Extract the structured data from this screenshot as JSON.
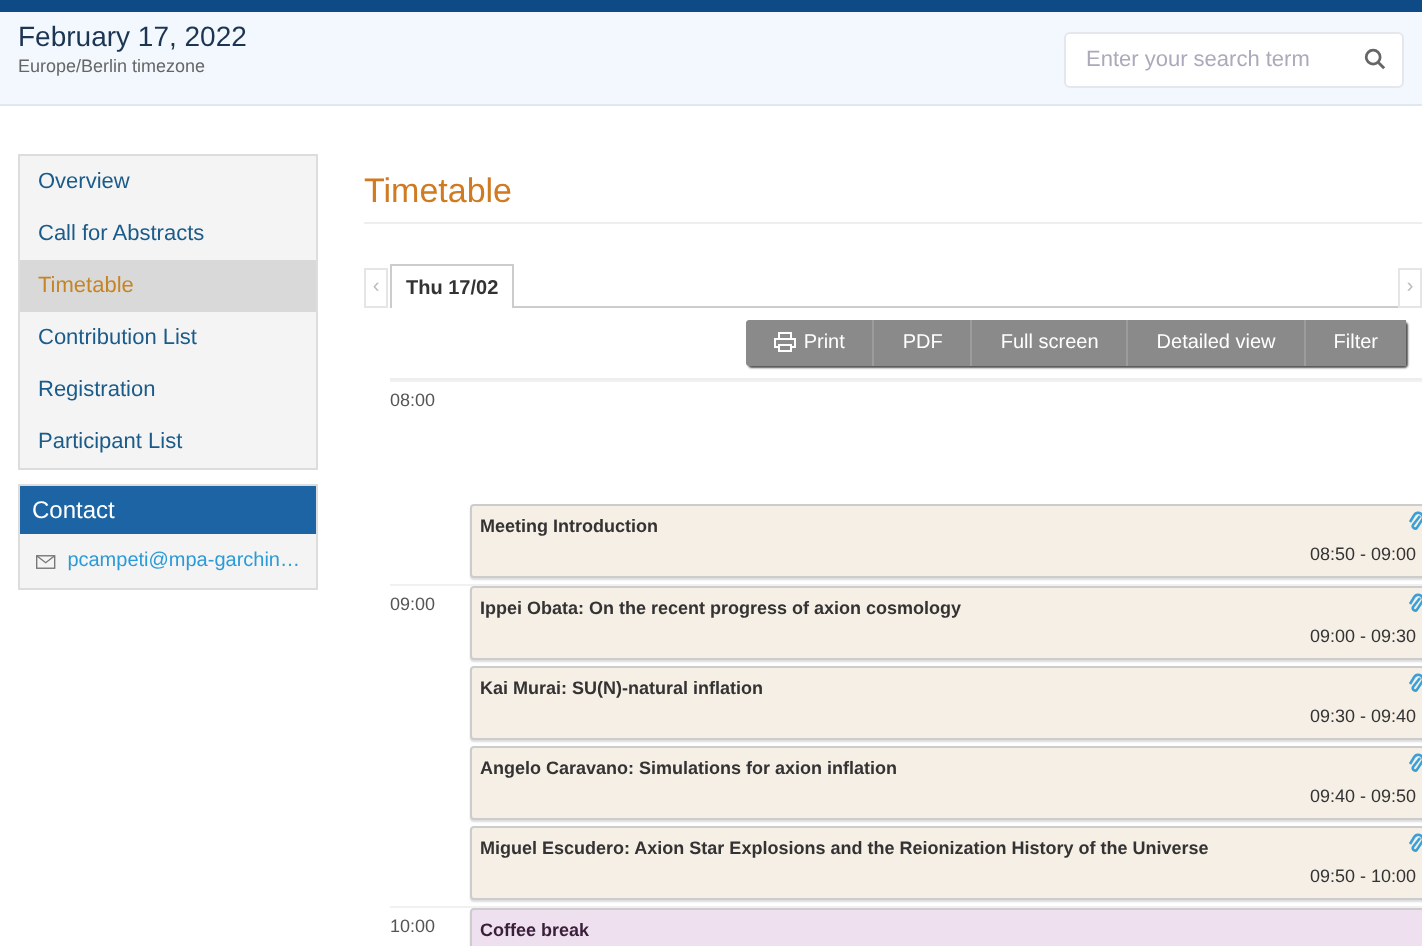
{
  "header": {
    "date": "February 17, 2022",
    "timezone": "Europe/Berlin timezone",
    "search": {
      "placeholder": "Enter your search term"
    }
  },
  "sidebar": {
    "items": [
      {
        "label": "Overview",
        "selected": false
      },
      {
        "label": "Call for Abstracts",
        "selected": false
      },
      {
        "label": "Timetable",
        "selected": true
      },
      {
        "label": "Contribution List",
        "selected": false
      },
      {
        "label": "Registration",
        "selected": false
      },
      {
        "label": "Participant List",
        "selected": false
      }
    ],
    "contact": {
      "title": "Contact",
      "email": "pcampeti@mpa-garchin…"
    }
  },
  "main": {
    "title": "Timetable",
    "nav": {
      "prev": "‹",
      "next": "›"
    },
    "days": [
      {
        "label": "Thu 17/02",
        "selected": true
      }
    ],
    "toolbar": [
      {
        "label": "Print",
        "kind": "print"
      },
      {
        "label": "PDF",
        "kind": "plain"
      },
      {
        "label": "Full screen",
        "kind": "plain"
      },
      {
        "label": "Detailed view",
        "kind": "plain"
      },
      {
        "label": "Filter",
        "kind": "plain"
      }
    ],
    "rows": [
      {
        "hour": "08:00",
        "kind": "empty"
      },
      {
        "kind": "contribution",
        "title": "Meeting Introduction",
        "time": "08:50 - 09:00"
      },
      {
        "hour": "09:00",
        "kind": "contribution",
        "title": "Ippei Obata: On the recent progress of axion cosmology",
        "time": "09:00 - 09:30"
      },
      {
        "kind": "contribution",
        "title": "Kai Murai: SU(N)-natural inflation",
        "time": "09:30 - 09:40"
      },
      {
        "kind": "contribution",
        "title": "Angelo Caravano: Simulations for axion inflation",
        "time": "09:40 - 09:50"
      },
      {
        "kind": "contribution",
        "title": "Miguel Escudero: Axion Star Explosions and the Reionization History of the Universe",
        "time": "09:50 - 10:00"
      },
      {
        "hour": "10:00",
        "kind": "break",
        "title": "Coffee break"
      }
    ]
  }
}
